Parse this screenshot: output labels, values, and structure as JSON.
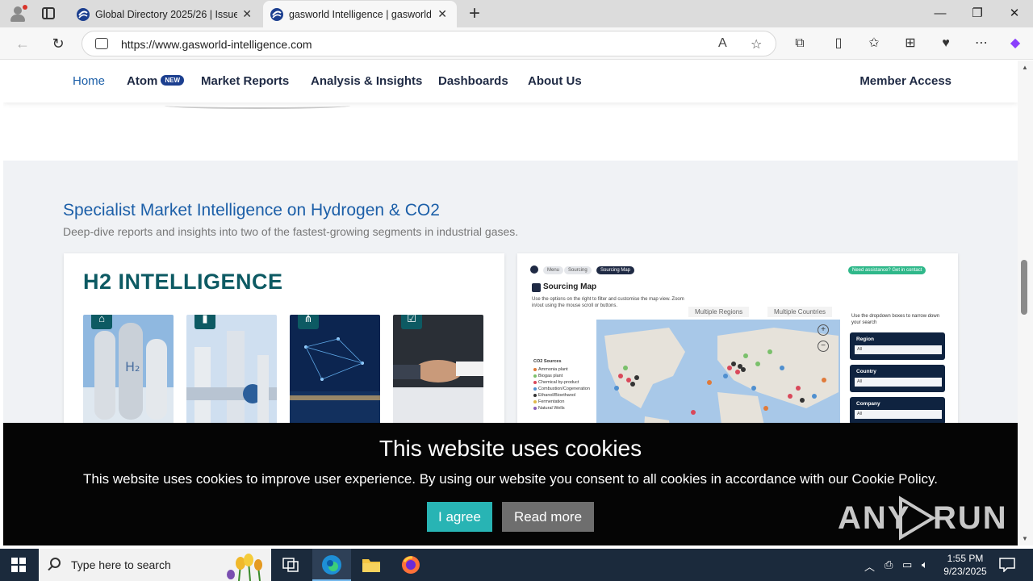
{
  "browser": {
    "tabs": [
      {
        "title": "Global Directory 2025/26 | Issue",
        "active": false
      },
      {
        "title": "gasworld Intelligence | gasworld B",
        "active": true
      }
    ],
    "url": "https://www.gasworld-intelligence.com"
  },
  "site_nav": {
    "items": [
      "Home",
      "Atom",
      "Market Reports",
      "Analysis & Insights",
      "Dashboards",
      "About Us"
    ],
    "atom_badge": "NEW",
    "member_bold": "Member",
    "member_rest": " Access"
  },
  "section": {
    "title": "Specialist Market Intelligence on Hydrogen & CO2",
    "subtitle": "Deep-dive reports and insights into two of the fastest-growing segments in industrial gases."
  },
  "h2_card": {
    "title": "H2 INTELLIGENCE"
  },
  "map_card": {
    "breadcrumbs": [
      "Menu",
      "Sourcing",
      "Sourcing Map"
    ],
    "assist": "Need assistance? Get in contact",
    "title": "Sourcing Map",
    "description": "Use the options on the right to filter and customise the map view. Zoom in/out using the mouse scroll or buttons.",
    "tabs": [
      "Multiple Regions",
      "Multiple Countries"
    ],
    "side_help": "Use the dropdown boxes to narrow down your search",
    "filters": [
      {
        "label": "Region",
        "value": "All"
      },
      {
        "label": "Country",
        "value": "All"
      },
      {
        "label": "Company",
        "value": "All"
      }
    ],
    "legend_title": "CO2 Sources",
    "legend": [
      {
        "label": "Ammonia plant",
        "color": "#e07a3a"
      },
      {
        "label": "Biogas plant",
        "color": "#7ac06b"
      },
      {
        "label": "Chemical by-product",
        "color": "#d9485a"
      },
      {
        "label": "Combustion/Cogeneration",
        "color": "#4f8fcf"
      },
      {
        "label": "Ethanol/Bioethanol",
        "color": "#333333"
      },
      {
        "label": "Fermentation",
        "color": "#e0b94a"
      },
      {
        "label": "Natural Wells",
        "color": "#8a5fb8"
      }
    ],
    "zoom_in": "+",
    "zoom_out": "−"
  },
  "cookie": {
    "title": "This website uses cookies",
    "text": "This website uses cookies to improve user experience. By using our website you consent to all cookies in accordance with our Cookie Policy.",
    "agree": "I agree",
    "more": "Read more"
  },
  "watermark": {
    "a": "ANY",
    "b": "RUN"
  },
  "taskbar": {
    "search_placeholder": "Type here to search",
    "time": "1:55 PM",
    "date": "9/23/2025"
  },
  "colors": {
    "accent_blue": "#1c5fa8",
    "teal": "#0d5a63",
    "agree_button": "#28b4b4"
  }
}
